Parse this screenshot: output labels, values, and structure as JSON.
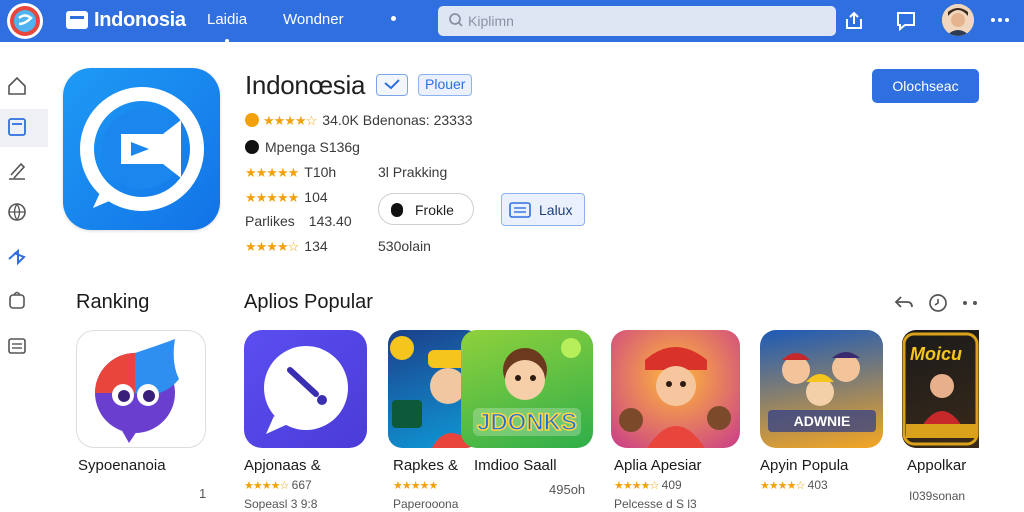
{
  "topbar": {
    "brand": "Indonosia",
    "nav": [
      "Laidia",
      "Wondner"
    ],
    "search_placeholder": "Kiplimn",
    "icons": [
      "logo-icon",
      "store-icon",
      "search-icon",
      "share-icon",
      "chat-icon",
      "avatar",
      "more-icon"
    ]
  },
  "sidebar": {
    "items": [
      "home-icon",
      "apps-icon",
      "edit-icon",
      "globe-icon",
      "bluetooth-icon",
      "bag-icon",
      "list-icon"
    ],
    "active_index": 1
  },
  "app": {
    "title": "Indonœsia",
    "tag": "Plouer",
    "rating_text": "34.0K Bdenonas: 23333",
    "developer": "Mpenga S136g",
    "reviews_1": "T10h",
    "reviews_2": "104",
    "label_row": "Parlikes",
    "label_value": "143.40",
    "reviews_3": "134",
    "right_1": "3l Prakking",
    "right_2": "530olain",
    "action_1": "Frokle",
    "action_2": "Lalux",
    "get_button": "Olochseac"
  },
  "sections": {
    "ranking_title": "Ranking",
    "popular_title": "Aplios Popular"
  },
  "ranking_card": {
    "name": "Sypoenanoia",
    "rank": "1"
  },
  "popular_cards": [
    {
      "name": "Apjonaas  &",
      "stars": "★★★★☆",
      "rating": "667",
      "sub": "Sopeasl 3 9:8"
    },
    {
      "name": "Rapkes &",
      "stars": "★★★★★",
      "rating": "",
      "sub": "Paperooona"
    },
    {
      "name": "Imdioo Saall",
      "stars": "",
      "rating": "",
      "sub": "",
      "size": "495oh"
    },
    {
      "name": "Aplia Apesiar",
      "stars": "★★★★☆",
      "rating": "409",
      "sub": "Pelcesse d S l3"
    },
    {
      "name": "Apyin Popula",
      "stars": "★★★★☆",
      "rating": "403",
      "sub": ""
    },
    {
      "name": "Appolkar",
      "stars": "",
      "rating": "",
      "sub": "I039sonan"
    }
  ],
  "colors": {
    "brand_blue": "#2f6fe0",
    "star": "#f2a10c",
    "app_icon": "#1a8cf0"
  }
}
